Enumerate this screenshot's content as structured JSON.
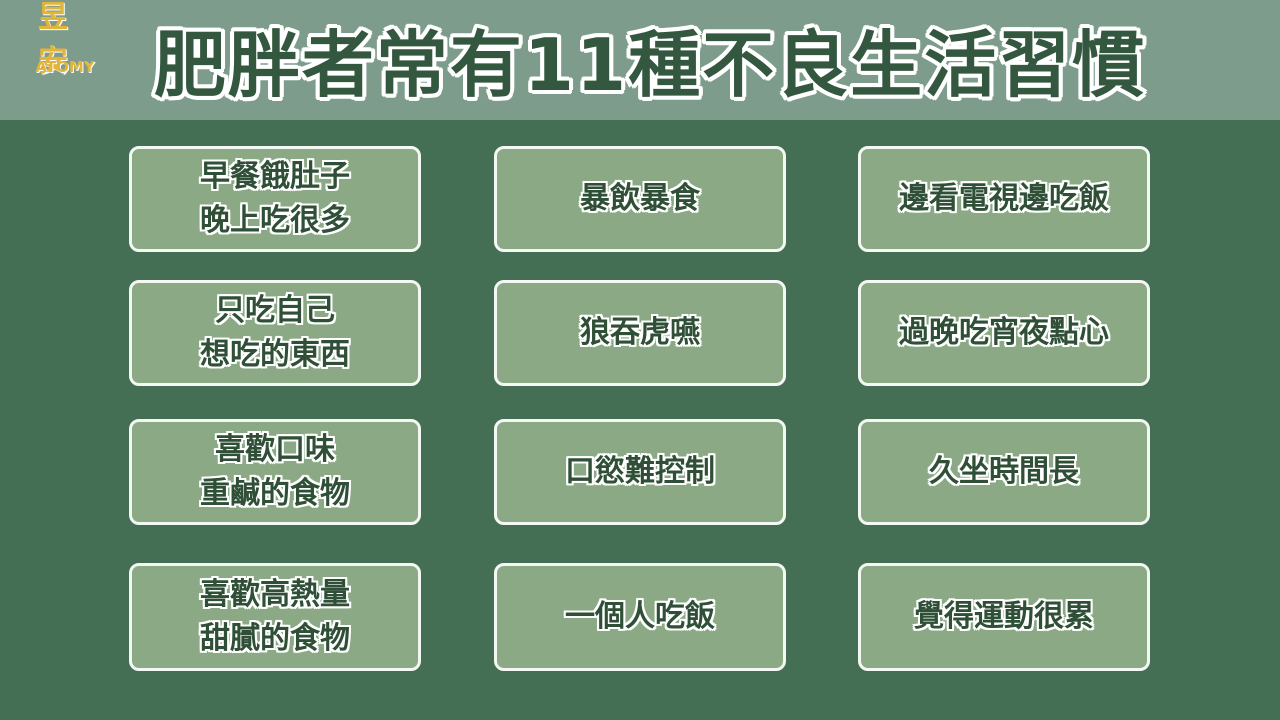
{
  "logo": {
    "mark": "昱安",
    "text": "ATOMY"
  },
  "title": "肥胖者常有11種不良生活習慣",
  "cards": [
    {
      "line1": "早餐餓肚子",
      "line2": "晚上吃很多"
    },
    {
      "line1": "暴飲暴食",
      "line2": ""
    },
    {
      "line1": "邊看電視邊吃飯",
      "line2": ""
    },
    {
      "line1": "只吃自己",
      "line2": "想吃的東西"
    },
    {
      "line1": "狼吞虎嚥",
      "line2": ""
    },
    {
      "line1": "過晚吃宵夜點心",
      "line2": ""
    },
    {
      "line1": "喜歡口味",
      "line2": "重鹹的食物"
    },
    {
      "line1": "口慾難控制",
      "line2": ""
    },
    {
      "line1": "久坐時間長",
      "line2": ""
    },
    {
      "line1": "喜歡高熱量",
      "line2": "甜膩的食物"
    },
    {
      "line1": "一個人吃飯",
      "line2": ""
    },
    {
      "line1": "覺得運動很累",
      "line2": ""
    }
  ]
}
